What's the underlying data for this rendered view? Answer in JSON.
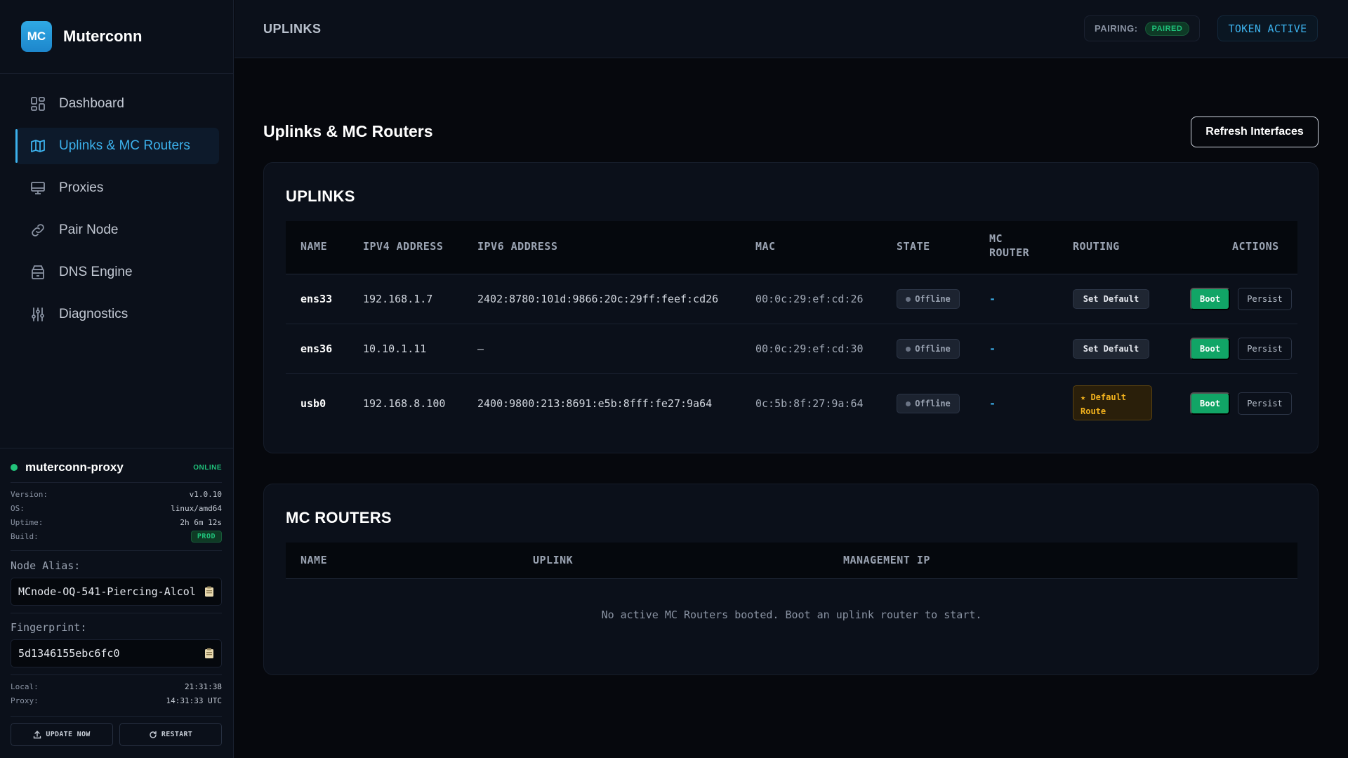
{
  "brand": {
    "logo_text": "MC",
    "name": "Muterconn"
  },
  "sidebar": {
    "items": [
      {
        "label": "Dashboard",
        "icon": "grid-icon"
      },
      {
        "label": "Uplinks & MC Routers",
        "icon": "map-icon",
        "active": true
      },
      {
        "label": "Proxies",
        "icon": "monitor-icon"
      },
      {
        "label": "Pair Node",
        "icon": "link-icon"
      },
      {
        "label": "DNS Engine",
        "icon": "database-icon"
      },
      {
        "label": "Diagnostics",
        "icon": "sliders-icon"
      }
    ]
  },
  "node": {
    "name": "muterconn-proxy",
    "status": "ONLINE",
    "version_label": "Version:",
    "version": "v1.0.10",
    "os_label": "OS:",
    "os": "linux/amd64",
    "uptime_label": "Uptime:",
    "uptime": "2h 6m 12s",
    "build_label": "Build:",
    "build": "PROD",
    "alias_label": "Node Alias:",
    "alias": "MCnode-OQ-541-Piercing-Alcol",
    "fingerprint_label": "Fingerprint:",
    "fingerprint": "5d1346155ebc6fc0",
    "local_label": "Local:",
    "local": "21:31:38",
    "proxy_label": "Proxy:",
    "proxy": "14:31:33 UTC",
    "update_label": "UPDATE NOW",
    "restart_label": "RESTART"
  },
  "topbar": {
    "title": "UPLINKS",
    "pairing_label": "PAIRING:",
    "pairing_value": "PAIRED",
    "token_label": "TOKEN ACTIVE"
  },
  "main": {
    "title": "Uplinks & MC Routers",
    "refresh_label": "Refresh Interfaces",
    "uplinks": {
      "title": "UPLINKS",
      "columns": {
        "name": "NAME",
        "ipv4": "IPV4 ADDRESS",
        "ipv6": "IPV6 ADDRESS",
        "mac": "MAC",
        "state": "STATE",
        "mc_router_1": "MC",
        "mc_router_2": "ROUTER",
        "routing": "ROUTING",
        "actions": "ACTIONS"
      },
      "rows": [
        {
          "name": "ens33",
          "ipv4": "192.168.1.7",
          "ipv6": "2402:8780:101d:9866:20c:29ff:feef:cd26",
          "mac": "00:0c:29:ef:cd:26",
          "state": "Offline",
          "mc_router": "-",
          "routing": "Set Default",
          "boot": "Boot",
          "persist": "Persist"
        },
        {
          "name": "ens36",
          "ipv4": "10.10.1.11",
          "ipv6": "—",
          "mac": "00:0c:29:ef:cd:30",
          "state": "Offline",
          "mc_router": "-",
          "routing": "Set Default",
          "boot": "Boot",
          "persist": "Persist"
        },
        {
          "name": "usb0",
          "ipv4": "192.168.8.100",
          "ipv6": "2400:9800:213:8691:e5b:8fff:fe27:9a64",
          "mac": "0c:5b:8f:27:9a:64",
          "state": "Offline",
          "mc_router": "-",
          "routing_line1": "★ Default",
          "routing_line2": "Route",
          "boot": "Boot",
          "persist": "Persist"
        }
      ]
    },
    "routers": {
      "title": "MC ROUTERS",
      "columns": {
        "name": "NAME",
        "uplink": "UPLINK",
        "mgmt_ip": "MANAGEMENT IP"
      },
      "empty": "No active MC Routers booted. Boot an uplink router to start."
    }
  },
  "colors": {
    "accent": "#3cb1ec",
    "success": "#11a566",
    "warning": "#f2b21d",
    "background": "#06080d"
  }
}
